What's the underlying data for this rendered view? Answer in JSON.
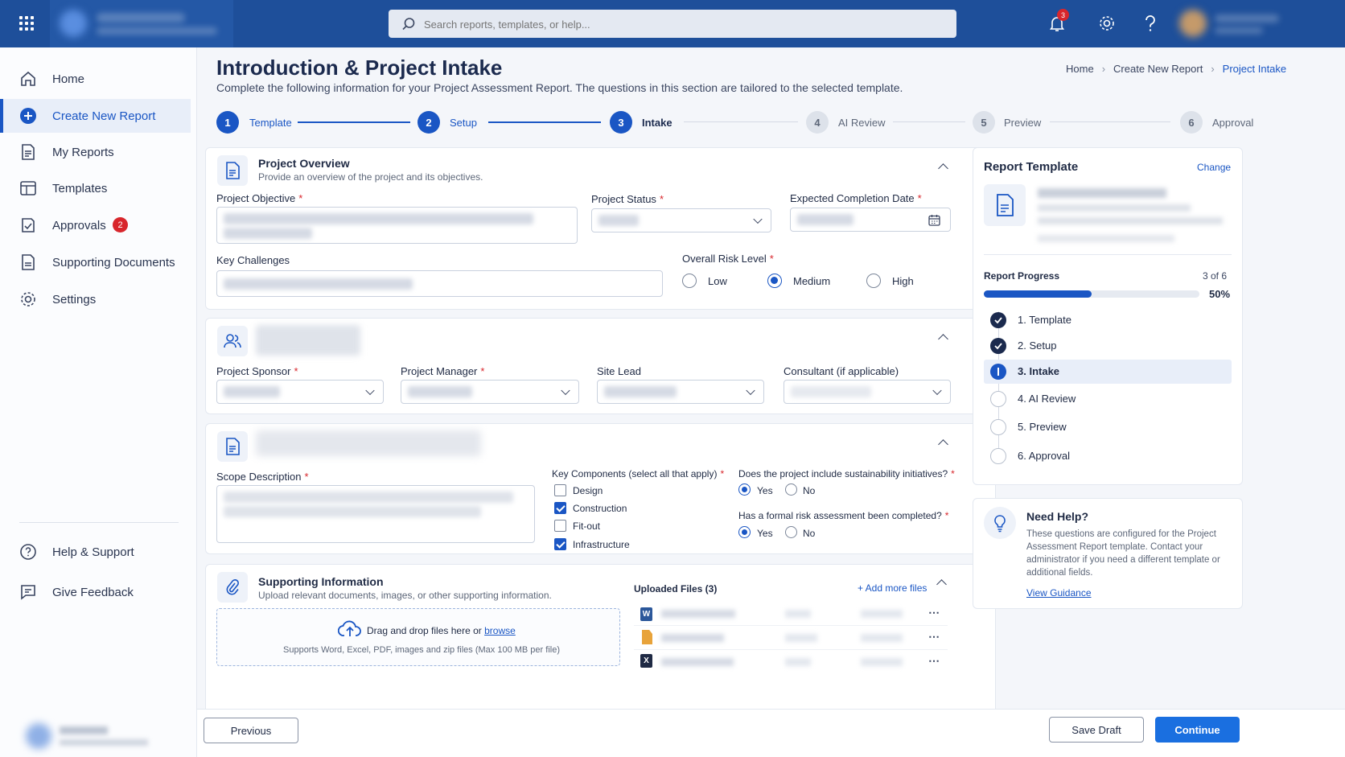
{
  "topbar": {
    "search_placeholder": "Search reports, templates, or help...",
    "notification_count": "3"
  },
  "sidebar": {
    "items": [
      {
        "label": "Home",
        "icon": "home-icon"
      },
      {
        "label": "Create New Report",
        "icon": "plus-circle-icon"
      },
      {
        "label": "My Reports",
        "icon": "document-icon"
      },
      {
        "label": "Templates",
        "icon": "template-icon"
      },
      {
        "label": "Approvals",
        "icon": "checkbox-icon",
        "badge": "2"
      },
      {
        "label": "Supporting Documents",
        "icon": "file-icon"
      },
      {
        "label": "Settings",
        "icon": "gear-icon"
      }
    ],
    "footer": [
      {
        "label": "Help & Support",
        "icon": "help-icon"
      },
      {
        "label": "Give Feedback",
        "icon": "feedback-icon"
      }
    ]
  },
  "page": {
    "title": "Introduction & Project Intake",
    "subtitle": "Complete the following information for your Project Assessment Report. The questions in this section are tailored to the selected template.",
    "breadcrumb": [
      "Home",
      "Create New Report",
      "Project Intake"
    ]
  },
  "stepper": [
    {
      "num": "1",
      "label": "Template"
    },
    {
      "num": "2",
      "label": "Setup"
    },
    {
      "num": "3",
      "label": "Intake"
    },
    {
      "num": "4",
      "label": "AI Review"
    },
    {
      "num": "5",
      "label": "Preview"
    },
    {
      "num": "6",
      "label": "Approval"
    }
  ],
  "overview": {
    "title": "Project Overview",
    "desc": "Provide an overview of the project and its objectives.",
    "objective_label": "Project Objective",
    "status_label": "Project Status",
    "date_label": "Expected Completion Date",
    "challenges_label": "Key Challenges",
    "risk_label": "Overall Risk Level",
    "risk_options": [
      "Low",
      "Medium",
      "High"
    ],
    "risk_selected": "Medium"
  },
  "team": {
    "sponsor_label": "Project Sponsor",
    "manager_label": "Project Manager",
    "site_label": "Site Lead",
    "consultant_label": "Consultant (if applicable)"
  },
  "scope": {
    "desc_label": "Scope Description",
    "components_label": "Key Components (select all that apply)",
    "components": [
      {
        "label": "Design",
        "checked": false
      },
      {
        "label": "Construction",
        "checked": true
      },
      {
        "label": "Fit-out",
        "checked": false
      },
      {
        "label": "Infrastructure",
        "checked": true
      }
    ],
    "q1": "Does the project include sustainability initiatives?",
    "q2": "Has a formal risk assessment been completed?",
    "yes": "Yes",
    "no": "No"
  },
  "supporting": {
    "title": "Supporting Information",
    "desc": "Upload relevant documents, images, or other supporting information.",
    "drop_text": "Drag and drop files here or",
    "browse": "browse",
    "supports": "Supports Word, Excel, PDF, images and zip files (Max 100 MB per file)",
    "uploaded": "Uploaded Files (3)",
    "add_more": "+ Add more files",
    "file_types": [
      "word",
      "pdf",
      "excel"
    ]
  },
  "template_panel": {
    "title": "Report Template",
    "change": "Change",
    "progress_label": "Report Progress",
    "progress_count": "3 of 6",
    "progress_pct": "50%",
    "progress_value": 0.5,
    "steps": [
      "1. Template",
      "2. Setup",
      "3. Intake",
      "4. AI Review",
      "5. Preview",
      "6. Approval"
    ]
  },
  "help_panel": {
    "title": "Need Help?",
    "text": "These questions are configured for the Project Assessment Report template. Contact your administrator if you need a different template or additional fields.",
    "link": "View Guidance"
  },
  "footer": {
    "previous": "Previous",
    "save": "Save Draft",
    "continue": "Continue"
  },
  "colors": {
    "brand": "#1e4f9a",
    "accent": "#1a56c4",
    "danger": "#d8262c"
  }
}
